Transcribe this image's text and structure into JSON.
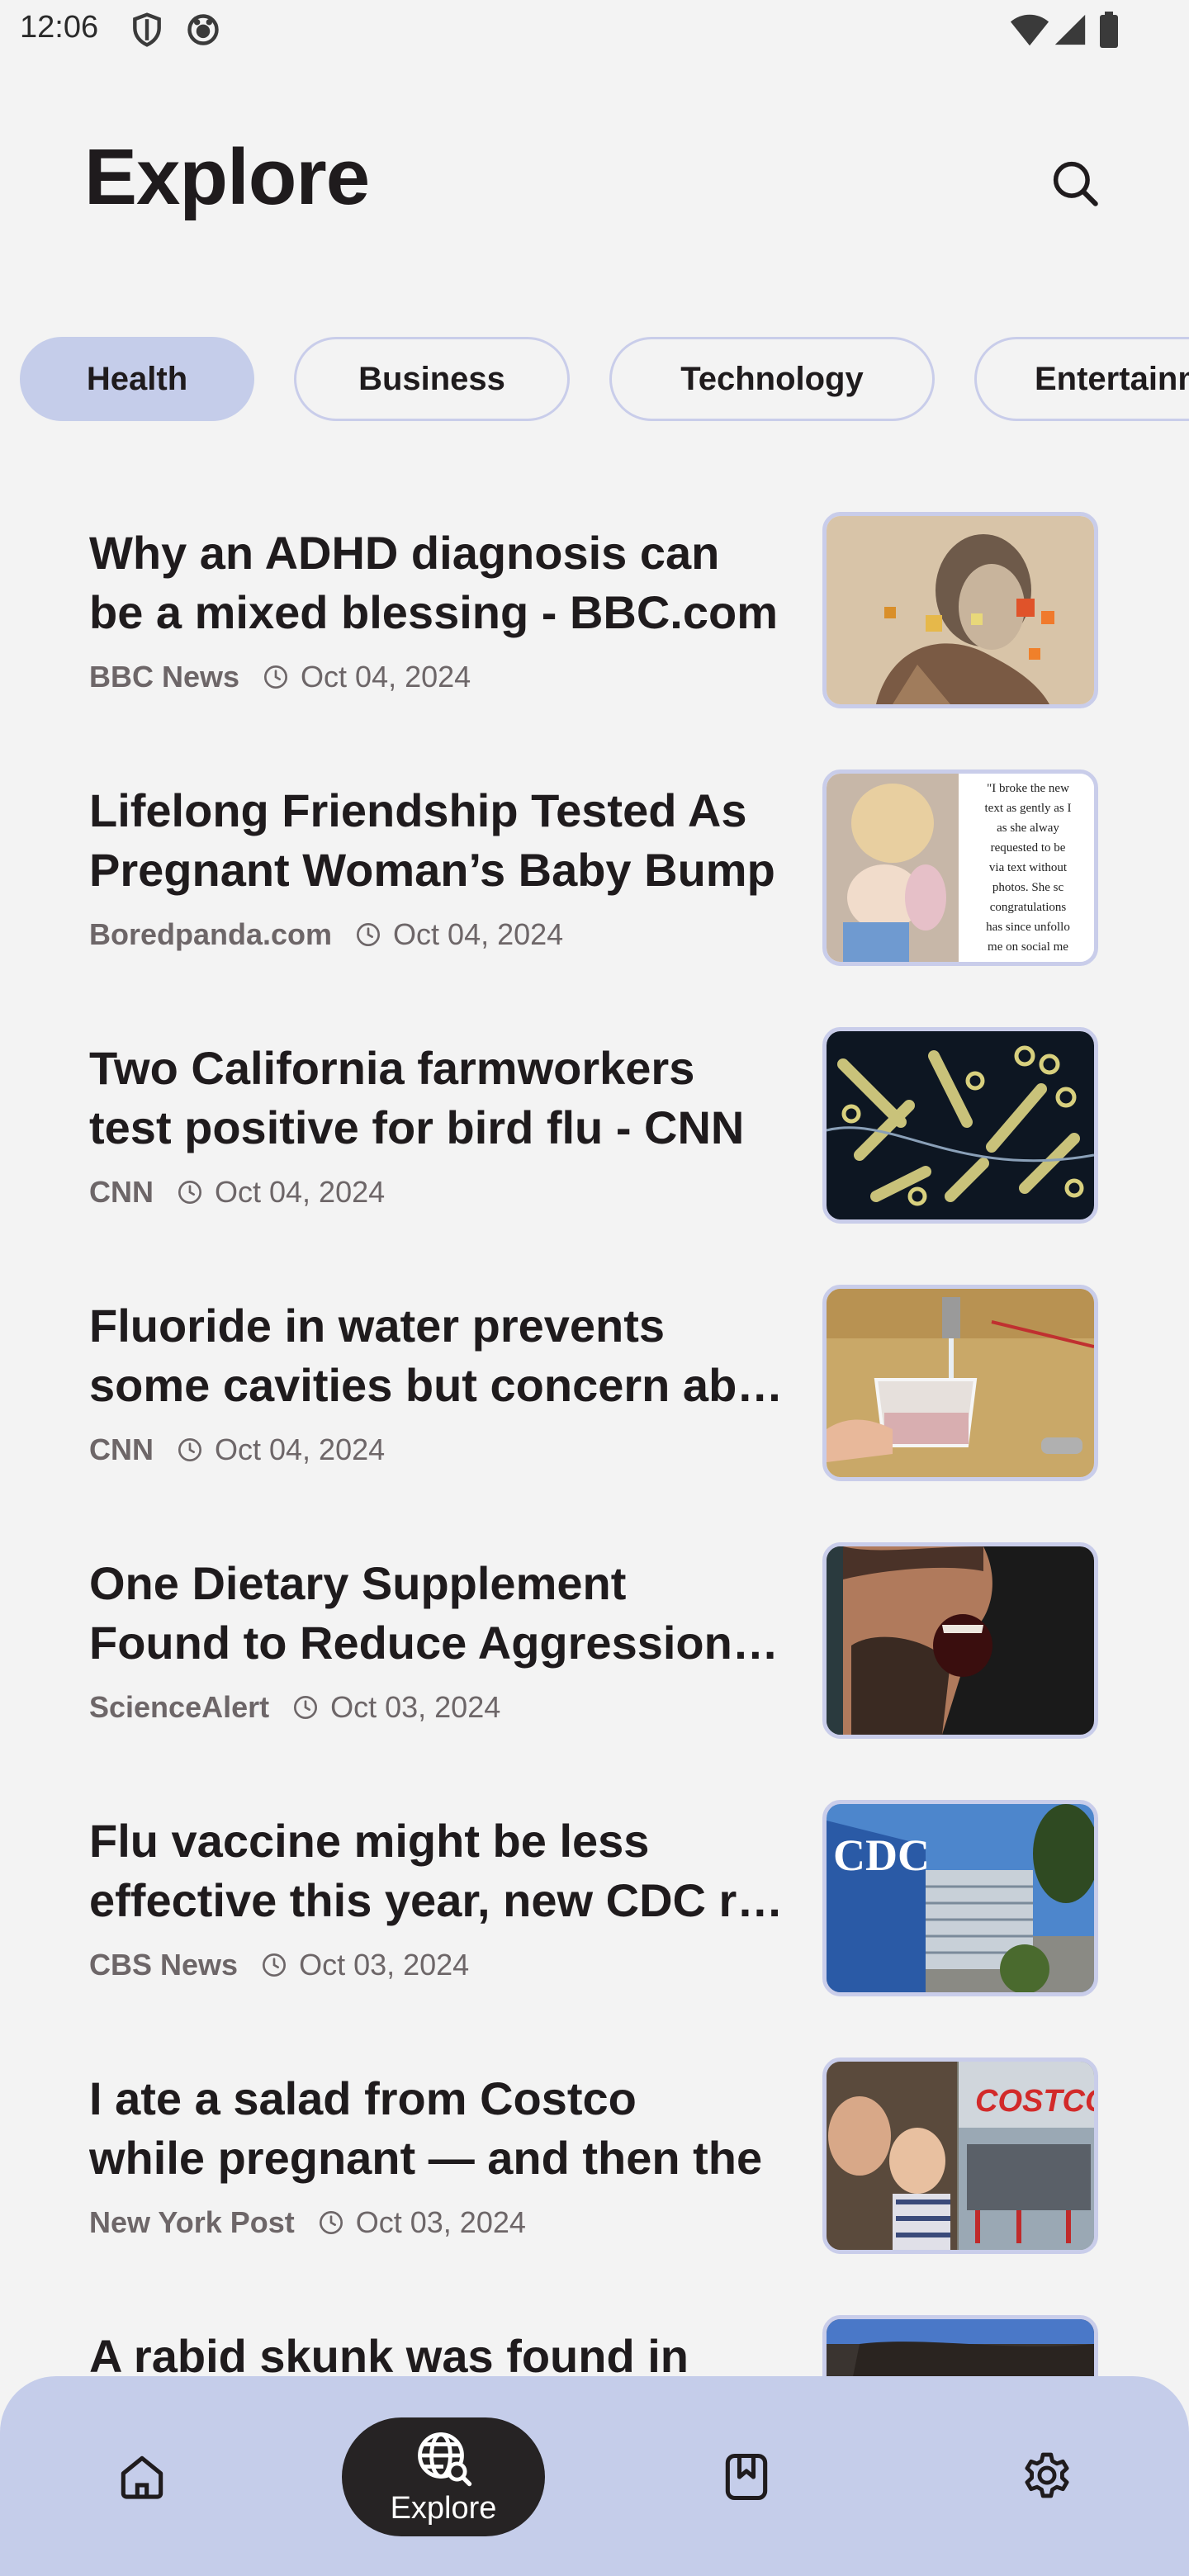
{
  "status_bar": {
    "time": "12:06",
    "left_icons": [
      "shield-icon",
      "app-notification-icon"
    ],
    "right_icons": [
      "wifi-icon",
      "signal-icon",
      "battery-icon"
    ]
  },
  "header": {
    "title": "Explore",
    "search_icon": "search-icon"
  },
  "categories": {
    "selected": "Health",
    "items": [
      "Health",
      "Business",
      "Technology",
      "Entertainment"
    ]
  },
  "articles": [
    {
      "title_line1": "Why an ADHD diagnosis can",
      "title_line2": "be a mixed blessing - BBC.com",
      "source": "BBC News",
      "date": "Oct 04, 2024",
      "thumb": "vintage-woman-collage"
    },
    {
      "title_line1": "Lifelong Friendship Tested As",
      "title_line2": "Pregnant Woman’s Baby Bump",
      "source": "Boredpanda.com",
      "date": "Oct 04, 2024",
      "thumb": "mother-baby-text-quote"
    },
    {
      "title_line1": "Two California farmworkers",
      "title_line2": "test positive for bird flu - CNN",
      "source": "CNN",
      "date": "Oct 04, 2024",
      "thumb": "virus-micrograph"
    },
    {
      "title_line1": "Fluoride in water prevents",
      "title_line2": "some cavities but concern about",
      "source": "CNN",
      "date": "Oct 04, 2024",
      "thumb": "glass-of-tap-water"
    },
    {
      "title_line1": "One Dietary Supplement",
      "title_line2": "Found to Reduce Aggression by",
      "source": "ScienceAlert",
      "date": "Oct 03, 2024",
      "thumb": "man-shouting"
    },
    {
      "title_line1": "Flu vaccine might be less",
      "title_line2": "effective this year, new CDC report",
      "source": "CBS News",
      "date": "Oct 03, 2024",
      "thumb": "cdc-building"
    },
    {
      "title_line1": "I ate a salad from Costco",
      "title_line2": "while pregnant — and then the",
      "source": "New York Post",
      "date": "Oct 03, 2024",
      "thumb": "mother-child-costco"
    },
    {
      "title_line1": "A rabid skunk was found in",
      "title_line2": "",
      "source": "",
      "date": "",
      "thumb": "skunk"
    }
  ],
  "thumb_text": {
    "quote_lines": [
      "\"I broke the new",
      "text as gently as I",
      "as she alway",
      "requested to be",
      "via text without",
      "photos. She sc",
      "congratulations",
      "has since unfollo",
      "me on social me"
    ],
    "cdc": "CDC",
    "costco": "COSTCO"
  },
  "bottom_nav": {
    "items": [
      {
        "name": "home",
        "icon": "home-icon"
      },
      {
        "name": "explore",
        "icon": "globe-search-icon",
        "label": "Explore",
        "active": true
      },
      {
        "name": "bookmarks",
        "icon": "bookmark-icon"
      },
      {
        "name": "settings",
        "icon": "gear-icon"
      }
    ]
  },
  "colors": {
    "background": "#f3f3f3",
    "accent": "#c5cdea",
    "text": "#1f1b1d",
    "meta": "#6d6668",
    "active_nav": "#262324"
  }
}
